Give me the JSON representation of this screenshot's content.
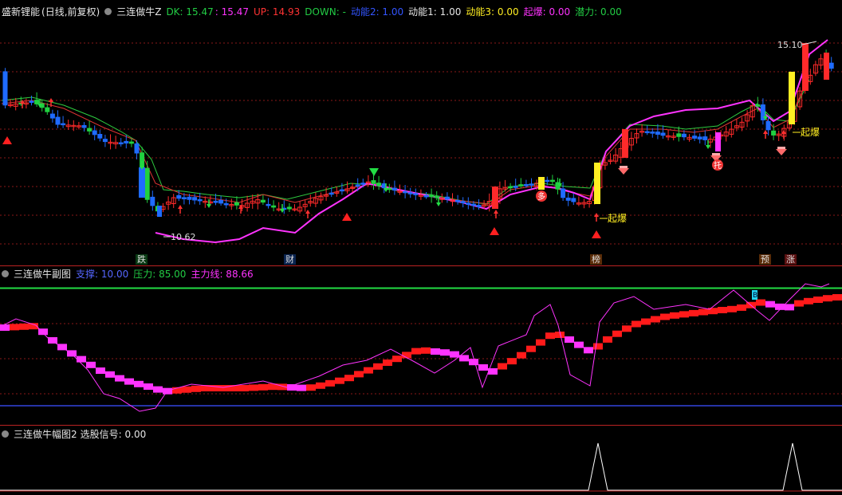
{
  "main": {
    "stock_name": "盛新锂能",
    "period": "(日线,前复权)",
    "indicator": "三连做牛Z",
    "dk_label": "DK: 15.47",
    "dk2_label": ": 15.47",
    "up_label": "UP: 14.93",
    "down_label": "DOWN: -",
    "energy2_label": "动能2: 1.00",
    "energy1_label": "动能1: 1.00",
    "energy3_label": "动能3: 0.00",
    "qibao_label": "起爆: 0.00",
    "potential_label": "潜力: 0.00",
    "high_mark": "15.10",
    "low_mark": "10.62",
    "qibao_tag": "起爆",
    "duo_tag": "多",
    "tuo_tag": "托",
    "x_tags": [
      {
        "text": "跌",
        "color": "#22c55e"
      },
      {
        "text": "财",
        "color": "#4aa3ff"
      },
      {
        "text": "榜",
        "color": "#d97706"
      },
      {
        "text": "预",
        "color": "#d97706"
      },
      {
        "text": "涨",
        "color": "#ff4d4d"
      }
    ]
  },
  "sub": {
    "title": "三连做牛副图",
    "support_label": "支撑: 10.00",
    "pressure_label": "压力: 85.00",
    "mainline_label": "主力线: 88.66",
    "support_value": 10,
    "pressure_value": 85,
    "mainline_value": 88.66,
    "marker": "B"
  },
  "amp": {
    "title": "三连做牛幅图2",
    "signal_label": "选股信号: 0.00"
  },
  "colors": {
    "up": "#ff2a2a",
    "down_blue": "#1f6bff",
    "down_green": "#20d040",
    "magenta": "#ff33ff",
    "green_line": "#2ecc40",
    "yellow": "#ffee22"
  }
}
